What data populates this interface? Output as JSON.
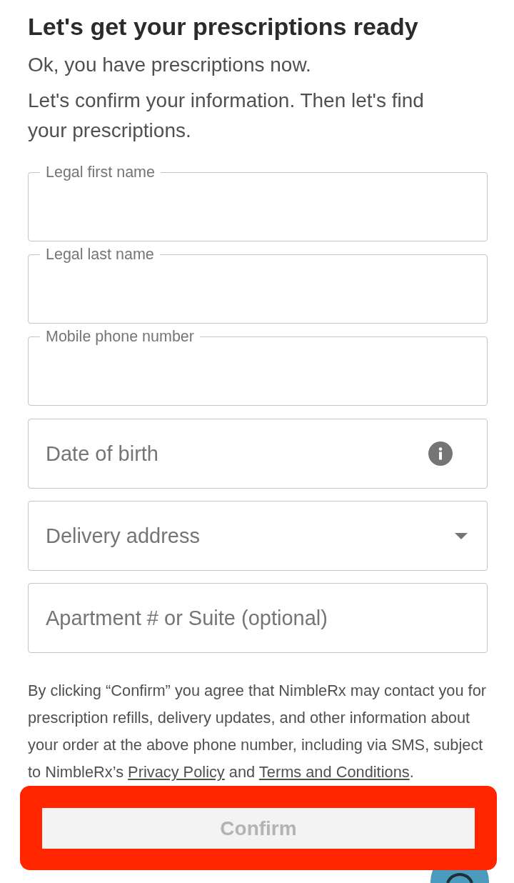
{
  "heading": "Let's get your prescriptions ready",
  "intro": [
    "Ok, you have prescriptions now.",
    "Let's confirm your information. Then let's find your prescriptions."
  ],
  "fields": [
    {
      "kind": "text",
      "label": "Legal first name"
    },
    {
      "kind": "text",
      "label": "Legal last name"
    },
    {
      "kind": "text",
      "label": "Mobile phone number"
    },
    {
      "kind": "date",
      "placeholder": "Date of birth"
    },
    {
      "kind": "select",
      "placeholder": "Delivery address"
    },
    {
      "kind": "text",
      "placeholder": "Apartment # or Suite (optional)"
    }
  ],
  "consent": [
    {
      "kind": "text",
      "text": "By clicking “Confirm” you agree that NimbleRx may contact you for prescription refills, delivery updates, and other information about your order at the above phone number, including via SMS, subject to NimbleRx’s "
    },
    {
      "kind": "link",
      "text": "Privacy Policy"
    },
    {
      "kind": "text",
      "text": " and "
    },
    {
      "kind": "link",
      "text": "Terms and Conditions"
    },
    {
      "kind": "text",
      "text": "."
    }
  ],
  "confirm_button": {
    "label": "Confirm",
    "disabled": true,
    "highlighted": true
  }
}
